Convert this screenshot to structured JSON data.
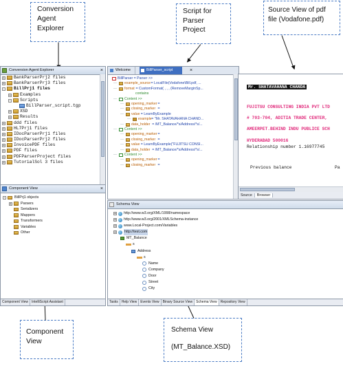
{
  "callouts": {
    "explorer": [
      "Conversion",
      "Agent",
      "Explorer"
    ],
    "script": [
      "Script for",
      "Parser",
      "Project"
    ],
    "source": [
      "Source View of pdf",
      "file (Vodafone.pdf)"
    ],
    "component": [
      "Component",
      "View"
    ],
    "schema": [
      "Schema View",
      "(MT_Balance.XSD)"
    ]
  },
  "explorer": {
    "title": "Conversion Agent Explorer",
    "items": [
      {
        "sign": "+",
        "label": "BankParserPrj2 files"
      },
      {
        "sign": "+",
        "label": "BankParserPrj3 files"
      },
      {
        "sign": "-",
        "label": "BillPrj1 files"
      },
      {
        "sign": "+",
        "label": "Examples"
      },
      {
        "sign": "-",
        "label": "Scripts"
      },
      {
        "sign": "",
        "label": "BillParser_script.tgp"
      },
      {
        "sign": "+",
        "label": "XSD"
      },
      {
        "sign": "+",
        "label": "Results"
      },
      {
        "sign": "+",
        "label": "ddd files"
      },
      {
        "sign": "+",
        "label": "HL7Prj1 files"
      },
      {
        "sign": "+",
        "label": "IDocParserPrj1 files"
      },
      {
        "sign": "+",
        "label": "IDocParserPrj2 files"
      },
      {
        "sign": "+",
        "label": "InvoicePDF files"
      },
      {
        "sign": "+",
        "label": "PDF files"
      },
      {
        "sign": "+",
        "label": "PDFParserProject files"
      },
      {
        "sign": "+",
        "label": "TutorialSol 3 files"
      }
    ]
  },
  "component_view": {
    "title": "Component View",
    "items": [
      "BillPrj1 objects",
      "Parsers",
      "Serializers",
      "Mappers",
      "Transformers",
      "Variables",
      "Other"
    ],
    "tabs": [
      "Component View",
      "IntelliScript Assistant"
    ]
  },
  "editor": {
    "tabs": [
      "Welcome",
      "BillParser_script"
    ],
    "lines": [
      {
        "text": "BillParser = Parser >>"
      },
      {
        "key": "example_source",
        "val": " = LocalFile(Vodafone\\Bill.pdf, ..."
      },
      {
        "key": "format",
        "val": " = CustomFormat( , , , (RemoveMarginSp..."
      },
      {
        "key": "",
        "val": "contains"
      },
      {
        "key": "",
        "val": "Content >>"
      },
      {
        "key": "opening_marker",
        "val": " ="
      },
      {
        "key": "closing_marker",
        "val": " ="
      },
      {
        "key": "value",
        "val": " = LearnByExample"
      },
      {
        "key": "example",
        "val": " = \"Mr. SHATAVAHANA CHAND..."
      },
      {
        "key": "data_holder",
        "val": " = /MT_Balance/*s/Address/*s/..."
      },
      {
        "key": "",
        "val": "Content >>"
      },
      {
        "key": "opening_marker",
        "val": " ="
      },
      {
        "key": "closing_marker",
        "val": " ="
      },
      {
        "key": "value",
        "val": " = LearnByExample(\"FUJITSU CONSI..."
      },
      {
        "key": "data_holder",
        "val": " = /MT_Balance/*s/Address/*s/..."
      },
      {
        "key": "",
        "val": "Content >>"
      },
      {
        "key": "opening_marker",
        "val": " ="
      },
      {
        "key": "closing_marker",
        "val": " ="
      }
    ]
  },
  "pdf_view": {
    "lines": [
      {
        "text": "Mr. SHATAVAHANA CHANDA",
        "style": "black"
      },
      {
        "text": "FUJITSU CONSULTING INDIA PVT LTD",
        "style": "pink"
      },
      {
        "text": "# 703-704, ADITIA TRADE CENTER,",
        "style": "pink"
      },
      {
        "text": "AMEERPET.BEHIND INDU PUBLICE SCH",
        "style": "pink"
      },
      {
        "text": "HYDERABAD 500016",
        "style": "pink"
      },
      {
        "text": "Relationship number 1.16977745",
        "style": "plain"
      },
      {
        "text": "Previous balance",
        "style": "plain"
      },
      {
        "text": "Pa",
        "style": "plain"
      }
    ],
    "tabs": [
      "Source",
      "Browser"
    ]
  },
  "schema_view": {
    "title": "Schema View",
    "items": [
      "http://www.w3.org/XML/1998/namespace",
      "http://www.w3.org/2001/XMLSchema-instance",
      "www.Local-Project.com/Variables",
      "http://test.com",
      "MT_Balance",
      "s",
      "Address",
      "s",
      "Name",
      "Company",
      "Door",
      "Street",
      "City"
    ],
    "tabs": [
      "Tasks",
      "Help View",
      "Events View",
      "Binary Source View",
      "Schema View",
      "Repository View"
    ]
  },
  "colors": {
    "pink": "#e0287a",
    "highlight": "#111111",
    "accent": "#4a7bc4"
  }
}
